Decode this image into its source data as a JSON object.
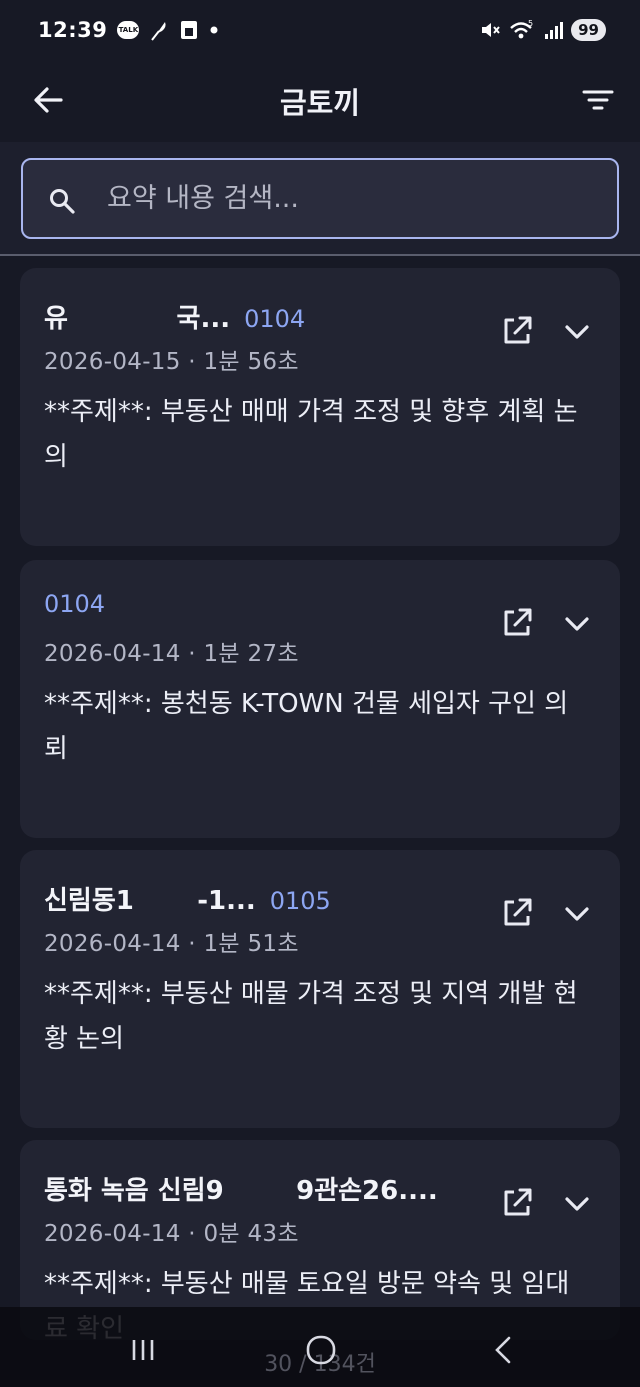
{
  "status": {
    "time": "12:39",
    "talk_label": "TALK",
    "battery": "99"
  },
  "header": {
    "title": "금토끼"
  },
  "search": {
    "placeholder": "요약 내용 검색..."
  },
  "cards": [
    {
      "title": "유            국...",
      "code": "0104",
      "meta": "2026-04-15 · 1분 56초",
      "summary": "**주제**: 부동산 매매 가격 조정 및 향후 계획 논의"
    },
    {
      "title": "",
      "code": "0104",
      "meta": "2026-04-14 · 1분 27초",
      "summary": "**주제**: 봉천동 K-TOWN 건물 세입자 구인 의뢰"
    },
    {
      "title": "신림동1       -1...",
      "code": "0105",
      "meta": "2026-04-14 · 1분 51초",
      "summary": "**주제**: 부동산 매물 가격 조정 및 지역 개발 현황 논의"
    },
    {
      "title": "통화 녹음 신림9        9관손26....",
      "code": "",
      "meta": "2026-04-14 · 0분 43초",
      "summary": "**주제**: 부동산 매물 토요일 방문 약속 및 임대료 확인"
    }
  ],
  "footer": {
    "count": "30 / 134건"
  }
}
